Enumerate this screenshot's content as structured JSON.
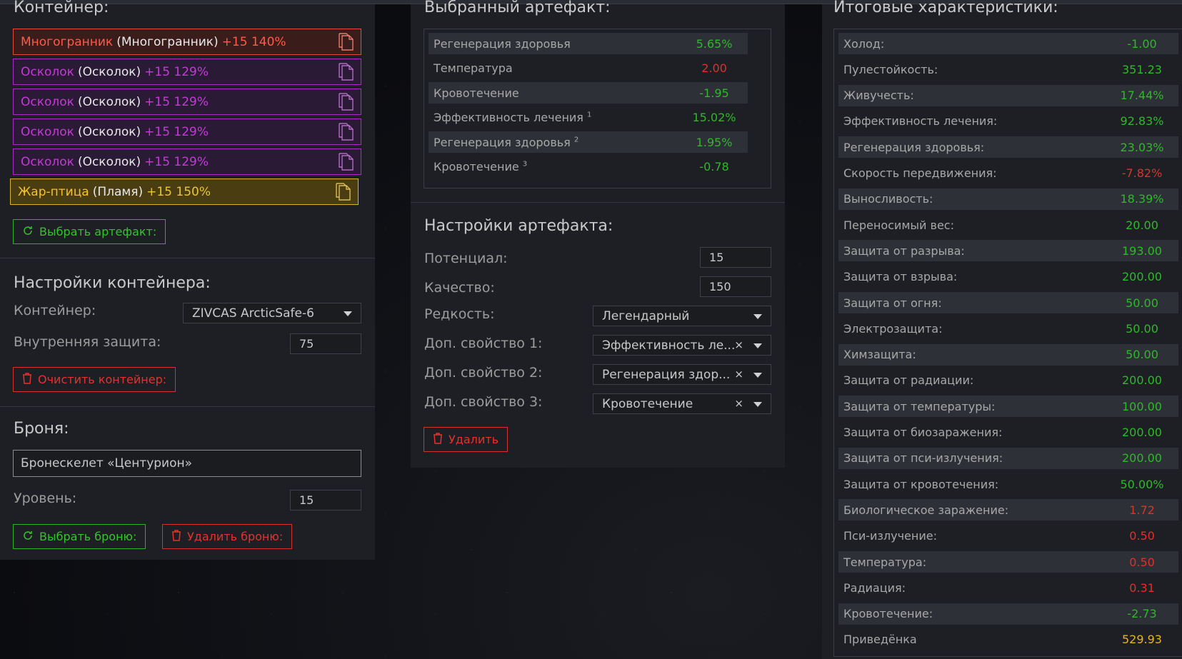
{
  "colors": {
    "green": "#2fb82a",
    "red": "#e0302a",
    "purple": "#c43ad8",
    "gold": "#e6b422",
    "panel": "#1d1f24"
  },
  "left": {
    "container_title": "Контейнер:",
    "artifacts": [
      {
        "name": "Многогранник",
        "type": "(Многогранник)",
        "bonus": "+15 140%",
        "style": "red",
        "icon": "copy-icon"
      },
      {
        "name": "Осколок",
        "type": "(Осколок)",
        "bonus": "+15 129%",
        "style": "purple",
        "icon": "copy-icon"
      },
      {
        "name": "Осколок",
        "type": "(Осколок)",
        "bonus": "+15 129%",
        "style": "purple",
        "icon": "copy-icon"
      },
      {
        "name": "Осколок",
        "type": "(Осколок)",
        "bonus": "+15 129%",
        "style": "purple",
        "icon": "copy-icon"
      },
      {
        "name": "Осколок",
        "type": "(Осколок)",
        "bonus": "+15 129%",
        "style": "purple",
        "icon": "copy-icon"
      },
      {
        "name": "Жар-птица",
        "type": "(Пламя)",
        "bonus": "+15 150%",
        "style": "gold",
        "icon": "copy-icon"
      }
    ],
    "choose_artifact_label": "Выбрать артефакт:",
    "container_settings_title": "Настройки контейнера:",
    "container_label": "Контейнер:",
    "container_value": "ZIVCAS ArcticSafe-6",
    "inner_protection_label": "Внутренняя защита:",
    "inner_protection_value": "75",
    "clear_container_label": "Очистить контейнер:",
    "armor_title": "Броня:",
    "armor_value": "Бронескелет «Центурион»",
    "level_label": "Уровень:",
    "level_value": "15",
    "choose_armor_label": "Выбрать броню:",
    "delete_armor_label": "Удалить броню:"
  },
  "mid": {
    "selected_title": "Выбранный артефакт:",
    "stats": [
      {
        "label": "Регенерация здоровья",
        "sup": "",
        "value": "5.65%",
        "color": "green"
      },
      {
        "label": "Температура",
        "sup": "",
        "value": "2.00",
        "color": "red"
      },
      {
        "label": "Кровотечение",
        "sup": "",
        "value": "-1.95",
        "color": "green"
      },
      {
        "label": "Эффективность лечения",
        "sup": "1",
        "value": "15.02%",
        "color": "green"
      },
      {
        "label": "Регенерация здоровья",
        "sup": "2",
        "value": "1.95%",
        "color": "green"
      },
      {
        "label": "Кровотечение",
        "sup": "3",
        "value": "-0.78",
        "color": "green"
      }
    ],
    "settings_title": "Настройки артефакта:",
    "potential_label": "Потенциал:",
    "potential_value": "15",
    "quality_label": "Качество:",
    "quality_value": "150",
    "rarity_label": "Редкость:",
    "rarity_value": "Легендарный",
    "extra1_label": "Доп. свойство 1:",
    "extra1_value": "Эффективность ле...",
    "extra2_label": "Доп. свойство 2:",
    "extra2_value": "Регенерация здор...",
    "extra3_label": "Доп. свойство 3:",
    "extra3_value": "Кровотечение",
    "clear_symbol": "×",
    "delete_label": "Удалить"
  },
  "right": {
    "title": "Итоговые характеристики:",
    "stats": [
      {
        "label": "Холод:",
        "value": "-1.00",
        "color": "green"
      },
      {
        "label": "Пулестойкость:",
        "value": "351.23",
        "color": "green"
      },
      {
        "label": "Живучесть:",
        "value": "17.44%",
        "color": "green"
      },
      {
        "label": "Эффективность лечения:",
        "value": "92.83%",
        "color": "green"
      },
      {
        "label": "Регенерация здоровья:",
        "value": "23.03%",
        "color": "green"
      },
      {
        "label": "Скорость передвижения:",
        "value": "-7.82%",
        "color": "red"
      },
      {
        "label": "Выносливость:",
        "value": "18.39%",
        "color": "green"
      },
      {
        "label": "Переносимый вес:",
        "value": "20.00",
        "color": "green"
      },
      {
        "label": "Защита от разрыва:",
        "value": "193.00",
        "color": "green"
      },
      {
        "label": "Защита от взрыва:",
        "value": "200.00",
        "color": "green"
      },
      {
        "label": "Защита от огня:",
        "value": "50.00",
        "color": "green"
      },
      {
        "label": "Электрозащита:",
        "value": "50.00",
        "color": "green"
      },
      {
        "label": "Химзащита:",
        "value": "50.00",
        "color": "green"
      },
      {
        "label": "Защита от радиации:",
        "value": "200.00",
        "color": "green"
      },
      {
        "label": "Защита от температуры:",
        "value": "100.00",
        "color": "green"
      },
      {
        "label": "Защита от биозаражения:",
        "value": "200.00",
        "color": "green"
      },
      {
        "label": "Защита от пси-излучения:",
        "value": "200.00",
        "color": "green"
      },
      {
        "label": "Защита от кровотечения:",
        "value": "50.00%",
        "color": "green"
      },
      {
        "label": "Биологическое заражение:",
        "value": "1.72",
        "color": "red"
      },
      {
        "label": "Пси-излучение:",
        "value": "0.50",
        "color": "red"
      },
      {
        "label": "Температура:",
        "value": "0.50",
        "color": "red"
      },
      {
        "label": "Радиация:",
        "value": "0.31",
        "color": "red"
      },
      {
        "label": "Кровотечение:",
        "value": "-2.73",
        "color": "green"
      },
      {
        "label": "Приведёнка",
        "value": "529.93",
        "color": "gold"
      }
    ]
  }
}
